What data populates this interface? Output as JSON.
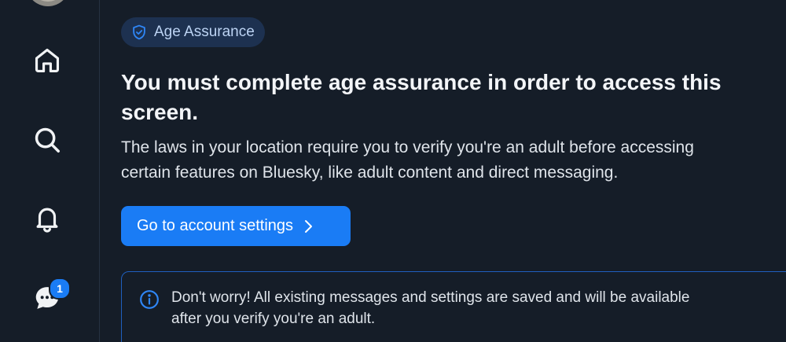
{
  "nav": {
    "items": [
      {
        "name": "home",
        "icon": "home-icon"
      },
      {
        "name": "search",
        "icon": "search-icon"
      },
      {
        "name": "notifications",
        "icon": "bell-icon"
      },
      {
        "name": "chat",
        "icon": "chat-icon",
        "badge": "1"
      }
    ],
    "avatar_icon": "avatar"
  },
  "main": {
    "pill": {
      "icon": "shield-check-icon",
      "label": "Age Assurance"
    },
    "title": "You must complete age assurance in order to access this screen.",
    "description": "The laws in your location require you to verify you're an adult before accessing\ncertain features on Bluesky, like adult content and direct messaging.",
    "cta": {
      "label": "Go to account settings",
      "icon": "chevron-right-icon"
    },
    "notice": {
      "icon": "info-circle-icon",
      "text": "Don't worry! All existing messages and settings are saved and will be available\nafter you verify you're an adult."
    }
  },
  "colors": {
    "background": "#151d28",
    "accent": "#1a7cf5",
    "pill_background": "#1d3150",
    "notice_border": "#1f5fbf"
  }
}
